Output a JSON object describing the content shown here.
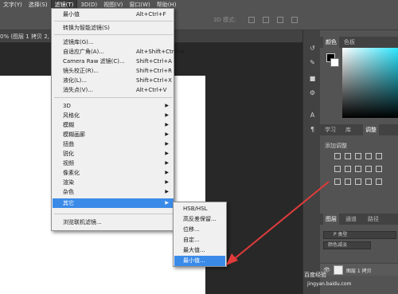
{
  "menubar": {
    "items": [
      "文字(Y)",
      "选择(S)",
      "滤镜(T)",
      "3D(D)",
      "视图(V)",
      "窗口(W)",
      "帮助(H)"
    ]
  },
  "optbar": {
    "hint": "3D 模式:"
  },
  "document_tab": {
    "label": "0% (图层 1 拷贝 2,"
  },
  "filter_menu": {
    "last_filter": {
      "label": "最小值",
      "shortcut": "Alt+Ctrl+F"
    },
    "smart_filter": "转换为智能滤镜(S)",
    "items_mid": [
      {
        "label": "滤镜库(G)...",
        "shortcut": ""
      },
      {
        "label": "自适应广角(A)...",
        "shortcut": "Alt+Shift+Ctrl+A"
      },
      {
        "label": "Camera Raw 滤镜(C)...",
        "shortcut": "Shift+Ctrl+A"
      },
      {
        "label": "镜头校正(R)...",
        "shortcut": "Shift+Ctrl+R"
      },
      {
        "label": "液化(L)...",
        "shortcut": "Shift+Ctrl+X"
      },
      {
        "label": "消失点(V)...",
        "shortcut": "Alt+Ctrl+V"
      }
    ],
    "submenus": [
      "3D",
      "风格化",
      "模糊",
      "模糊画廊",
      "扭曲",
      "锐化",
      "视频",
      "像素化",
      "渲染",
      "杂色",
      "其它"
    ],
    "browse": "浏览联机滤镜..."
  },
  "other_submenu": {
    "items": [
      "HSB/HSL",
      "高反差保留...",
      "位移...",
      "自定...",
      "最大值...",
      "最小值..."
    ],
    "highlighted_index": 5
  },
  "panels": {
    "color_tabs": [
      "颜色",
      "色板"
    ],
    "adjust_tabs": [
      "学习",
      "库",
      "调整"
    ],
    "adjust_label": "添加调整",
    "layers_tabs": [
      "图层",
      "通道",
      "路径"
    ],
    "layer_filter": "P 类型",
    "layer_mode": "颜色减淡",
    "layer_name": "图层 1 拷贝"
  },
  "watermark": {
    "line1": "百度经验",
    "line2": "jingyan.baidu.com"
  },
  "colors": {
    "highlight": "#3a8be8",
    "arrow": "#e23b3b",
    "menu_bg": "#f0f0f0"
  }
}
